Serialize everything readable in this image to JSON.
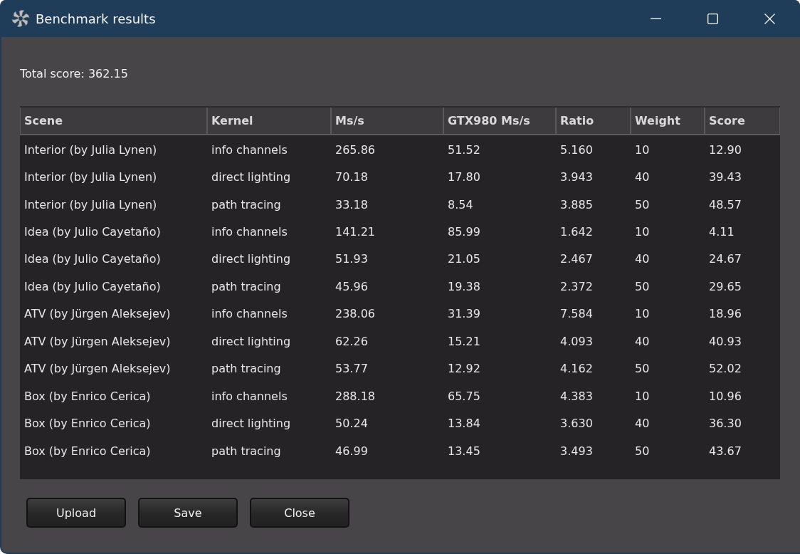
{
  "window": {
    "title": "Benchmark results"
  },
  "total_score": "Total score: 362.15",
  "table": {
    "columns": [
      "Scene",
      "Kernel",
      "Ms/s",
      "GTX980 Ms/s",
      "Ratio",
      "Weight",
      "Score"
    ],
    "rows": [
      [
        "Interior (by Julia Lynen)",
        "info channels",
        "265.86",
        "51.52",
        "5.160",
        "10",
        "12.90"
      ],
      [
        "Interior (by Julia Lynen)",
        "direct lighting",
        "70.18",
        "17.80",
        "3.943",
        "40",
        "39.43"
      ],
      [
        "Interior (by Julia Lynen)",
        "path tracing",
        "33.18",
        "8.54",
        "3.885",
        "50",
        "48.57"
      ],
      [
        "Idea (by Julio Cayetaño)",
        "info channels",
        "141.21",
        "85.99",
        "1.642",
        "10",
        "4.11"
      ],
      [
        "Idea (by Julio Cayetaño)",
        "direct lighting",
        "51.93",
        "21.05",
        "2.467",
        "40",
        "24.67"
      ],
      [
        "Idea (by Julio Cayetaño)",
        "path tracing",
        "45.96",
        "19.38",
        "2.372",
        "50",
        "29.65"
      ],
      [
        "ATV (by Jürgen Aleksejev)",
        "info channels",
        "238.06",
        "31.39",
        "7.584",
        "10",
        "18.96"
      ],
      [
        "ATV (by Jürgen Aleksejev)",
        "direct lighting",
        "62.26",
        "15.21",
        "4.093",
        "40",
        "40.93"
      ],
      [
        "ATV (by Jürgen Aleksejev)",
        "path tracing",
        "53.77",
        "12.92",
        "4.162",
        "50",
        "52.02"
      ],
      [
        "Box (by Enrico Cerica)",
        "info channels",
        "288.18",
        "65.75",
        "4.383",
        "10",
        "10.96"
      ],
      [
        "Box (by Enrico Cerica)",
        "direct lighting",
        "50.24",
        "13.84",
        "3.630",
        "40",
        "36.30"
      ],
      [
        "Box (by Enrico Cerica)",
        "path tracing",
        "46.99",
        "13.45",
        "3.493",
        "50",
        "43.67"
      ]
    ]
  },
  "buttons": [
    "Upload",
    "Save",
    "Close"
  ]
}
